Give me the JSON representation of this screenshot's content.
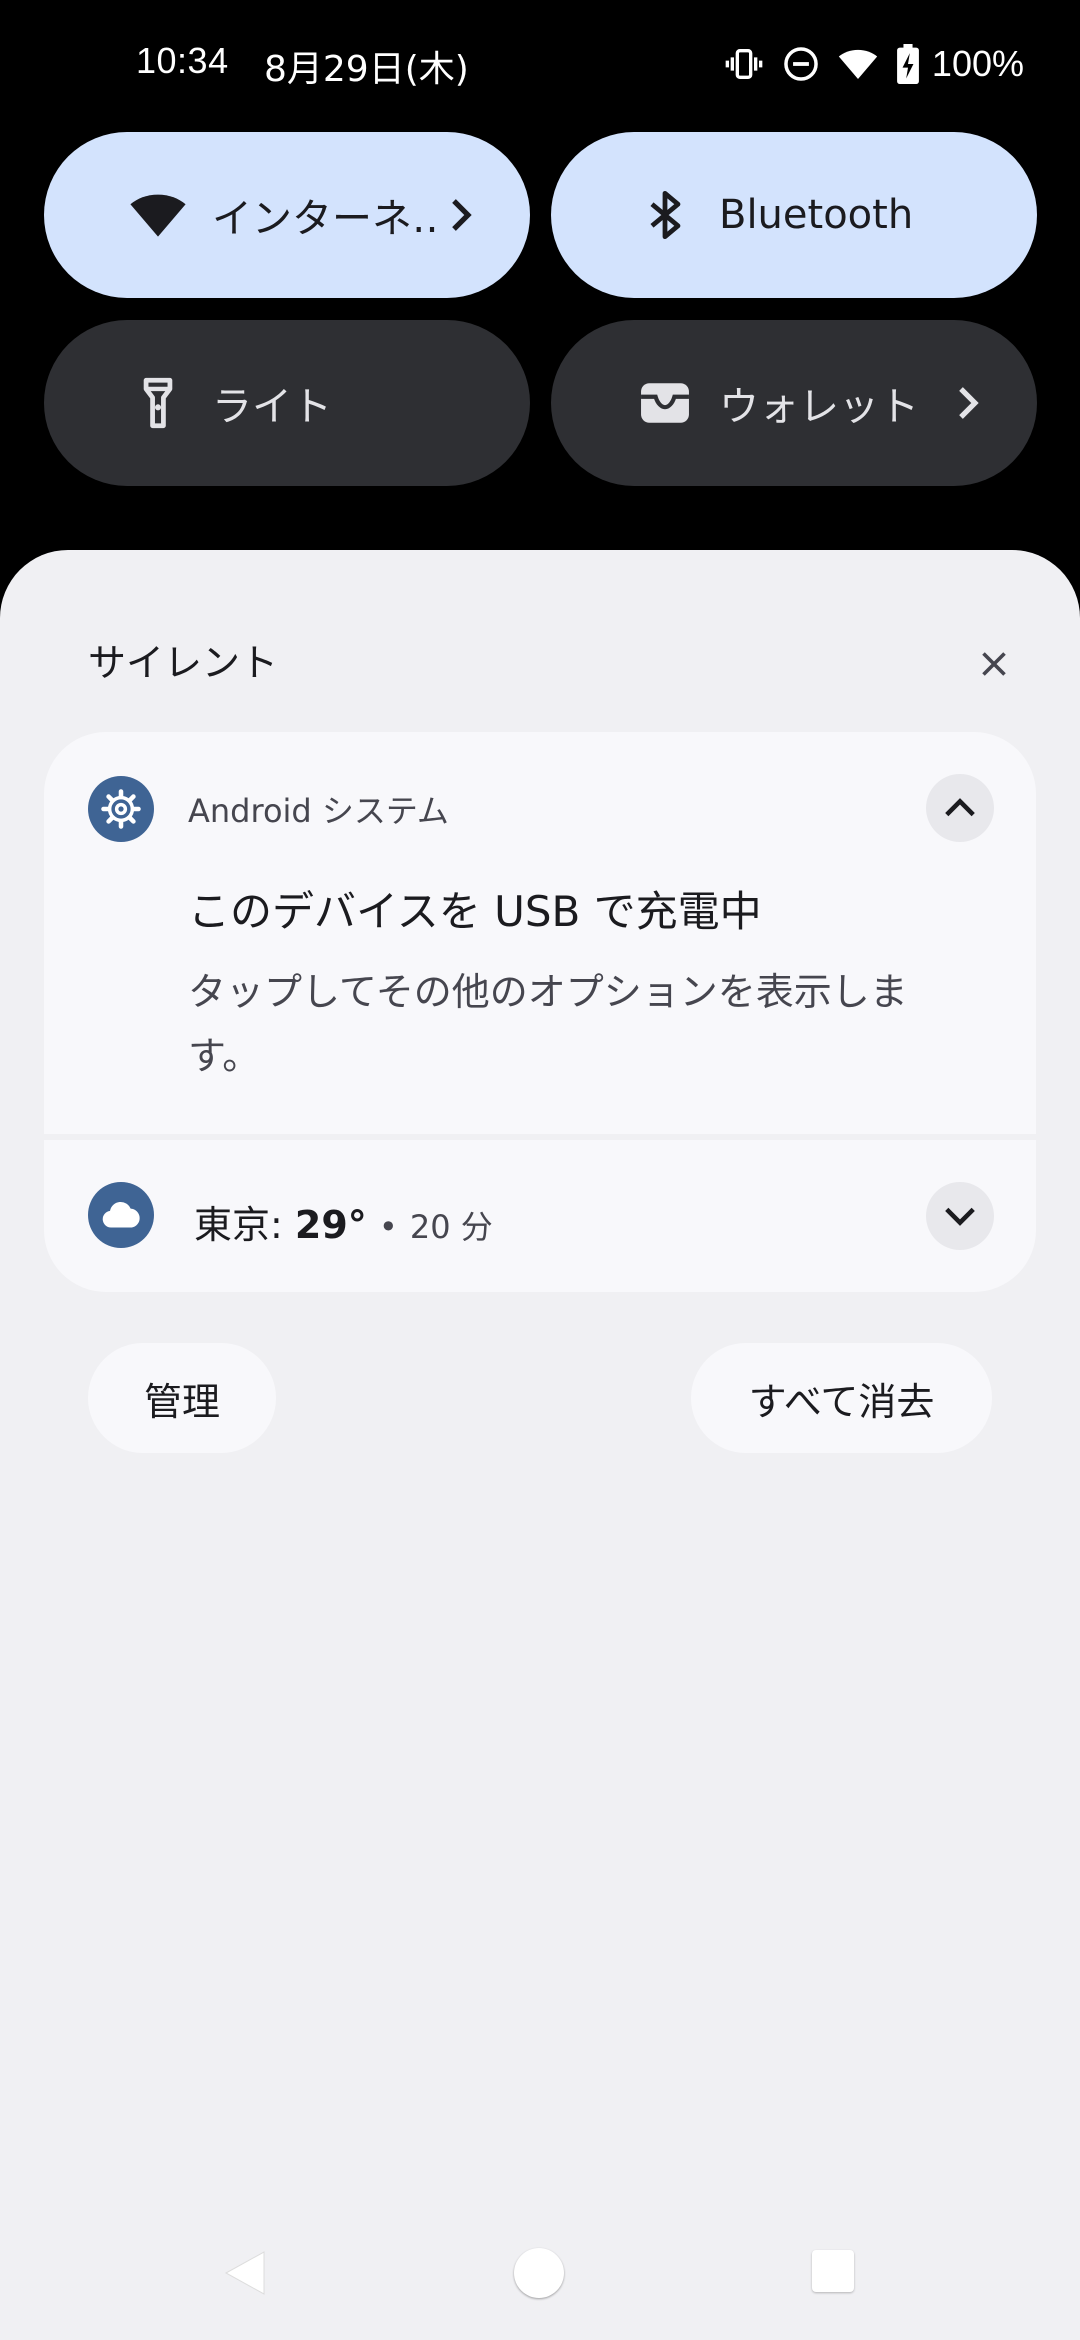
{
  "status_bar": {
    "time": "10:34",
    "date": "8月29日(木)",
    "battery": "100%",
    "icons": [
      "vibrate-icon",
      "do-not-disturb-icon",
      "wifi-icon",
      "battery-charging-icon"
    ]
  },
  "quick_settings": {
    "tiles": [
      {
        "label": "インターネ‥",
        "icon": "wifi-icon",
        "active": true,
        "has_chevron": true
      },
      {
        "label": "Bluetooth",
        "icon": "bluetooth-icon",
        "active": true,
        "has_chevron": false
      },
      {
        "label": "ライト",
        "icon": "flashlight-icon",
        "active": false,
        "has_chevron": false
      },
      {
        "label": "ウォレット",
        "icon": "wallet-icon",
        "active": false,
        "has_chevron": true
      }
    ]
  },
  "shade": {
    "section_header": "サイレント",
    "notifications": [
      {
        "app": "Android システム",
        "icon": "settings-gear-icon",
        "title": "このデバイスを USB で充電中",
        "text": "タップしてその他のオプションを表示します。",
        "expanded": true
      },
      {
        "icon": "cloud-icon",
        "place": "東京:",
        "temp": "29°",
        "separator": "•",
        "time": "20 分",
        "expanded": false
      }
    ],
    "manage_label": "管理",
    "clear_all_label": "すべて消去"
  },
  "colors": {
    "tile_active": "#d3e3fd",
    "tile_inactive": "#2e2f33",
    "shade_bg": "#f0f0f3",
    "app_icon_bg": "#3f6494"
  }
}
